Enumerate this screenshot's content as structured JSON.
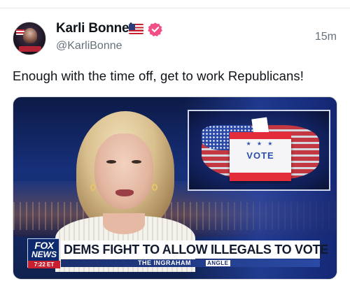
{
  "post": {
    "author": {
      "display_name": "Karli Bonne’",
      "handle": "@KarliBonne",
      "flag_emoji": "us-flag-icon",
      "verified_icon": "verified-badge-icon",
      "verified_color": "#f14f85",
      "avatar": "avatar"
    },
    "timestamp": "15m",
    "text": "Enough with the time off, get to work Republicans!",
    "media": {
      "type": "video-still",
      "network_logo_top": "FOX",
      "network_logo_bottom": "NEWS",
      "clock": "7:22 ET",
      "headline": "DEMS FIGHT TO ALLOW ILLEGALS TO VOTE",
      "show_name": "THE INGRAHAM",
      "show_name_suffix": "ANGLE",
      "inset_label": "VOTE",
      "inset_stars": "★ ★ ★"
    }
  },
  "colors": {
    "text_primary": "#0f1419",
    "text_secondary": "#66717a",
    "fox_blue": "#0d2a6e",
    "fox_red": "#c8202e"
  }
}
